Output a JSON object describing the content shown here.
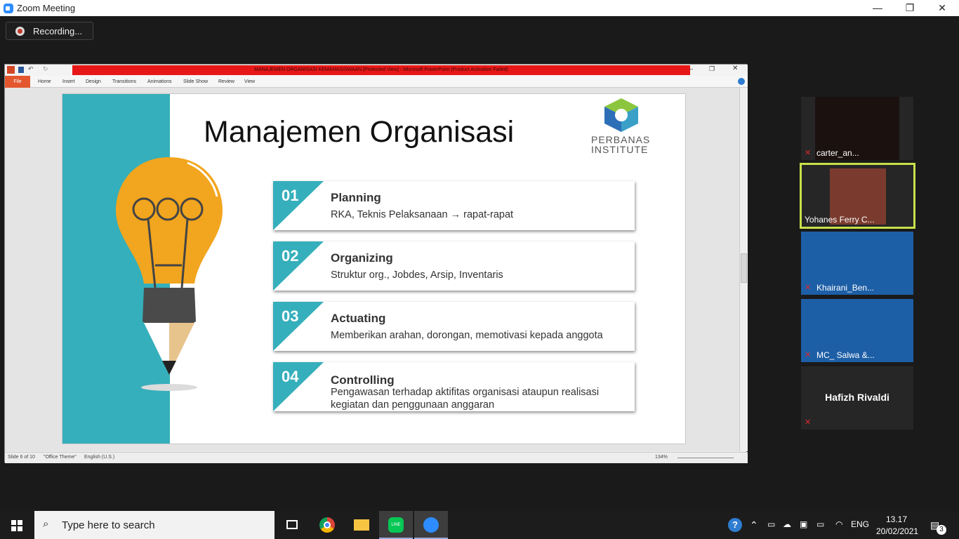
{
  "window": {
    "title": "Zoom Meeting",
    "minimize": "—",
    "restore": "❐",
    "close": "✕"
  },
  "recording": {
    "label": "Recording..."
  },
  "powerpoint": {
    "title": "MANAJEMEN ORGANISASI KEMAHASISWAAN [Protected View] - Microsoft PowerPoint (Product Activation Failed)",
    "tabs": [
      "File",
      "Home",
      "Insert",
      "Design",
      "Transitions",
      "Animations",
      "Slide Show",
      "Review",
      "View"
    ],
    "status": {
      "slide": "Slide 6 of 10",
      "theme": "\"Office Theme\"",
      "language": "English (U.S.)",
      "zoom": "134%"
    }
  },
  "slide": {
    "title": "Manajemen Organisasi",
    "logo_line1": "PERBANAS",
    "logo_line2": "INSTITUTE",
    "items": [
      {
        "num": "01",
        "title": "Planning",
        "desc": "RKA, Teknis Pelaksanaan → rapat-rapat"
      },
      {
        "num": "02",
        "title": "Organizing",
        "desc": "Struktur org., Jobdes, Arsip, Inventaris"
      },
      {
        "num": "03",
        "title": "Actuating",
        "desc": "Memberikan arahan, dorongan, memotivasi kepada anggota"
      },
      {
        "num": "04",
        "title": "Controlling",
        "desc": "Pengawasan terhadap aktifitas organisasi ataupun realisasi kegiatan dan penggunaan anggaran"
      }
    ]
  },
  "participants": [
    {
      "name": "carter_an..."
    },
    {
      "name": "Yohanes Ferry C..."
    },
    {
      "name": "Khairani_Ben..."
    },
    {
      "name": "MC_ Salwa &..."
    },
    {
      "name": "Hafizh Rivaldi"
    }
  ],
  "taskbar": {
    "search_placeholder": "Type here to search",
    "language": "ENG",
    "time": "13.17",
    "date": "20/02/2021",
    "notifications": "3"
  },
  "colors": {
    "teal": "#35afbb",
    "bulb": "#f2a51e",
    "active_speaker": "#c8e04a",
    "red_title": "#e81717"
  }
}
